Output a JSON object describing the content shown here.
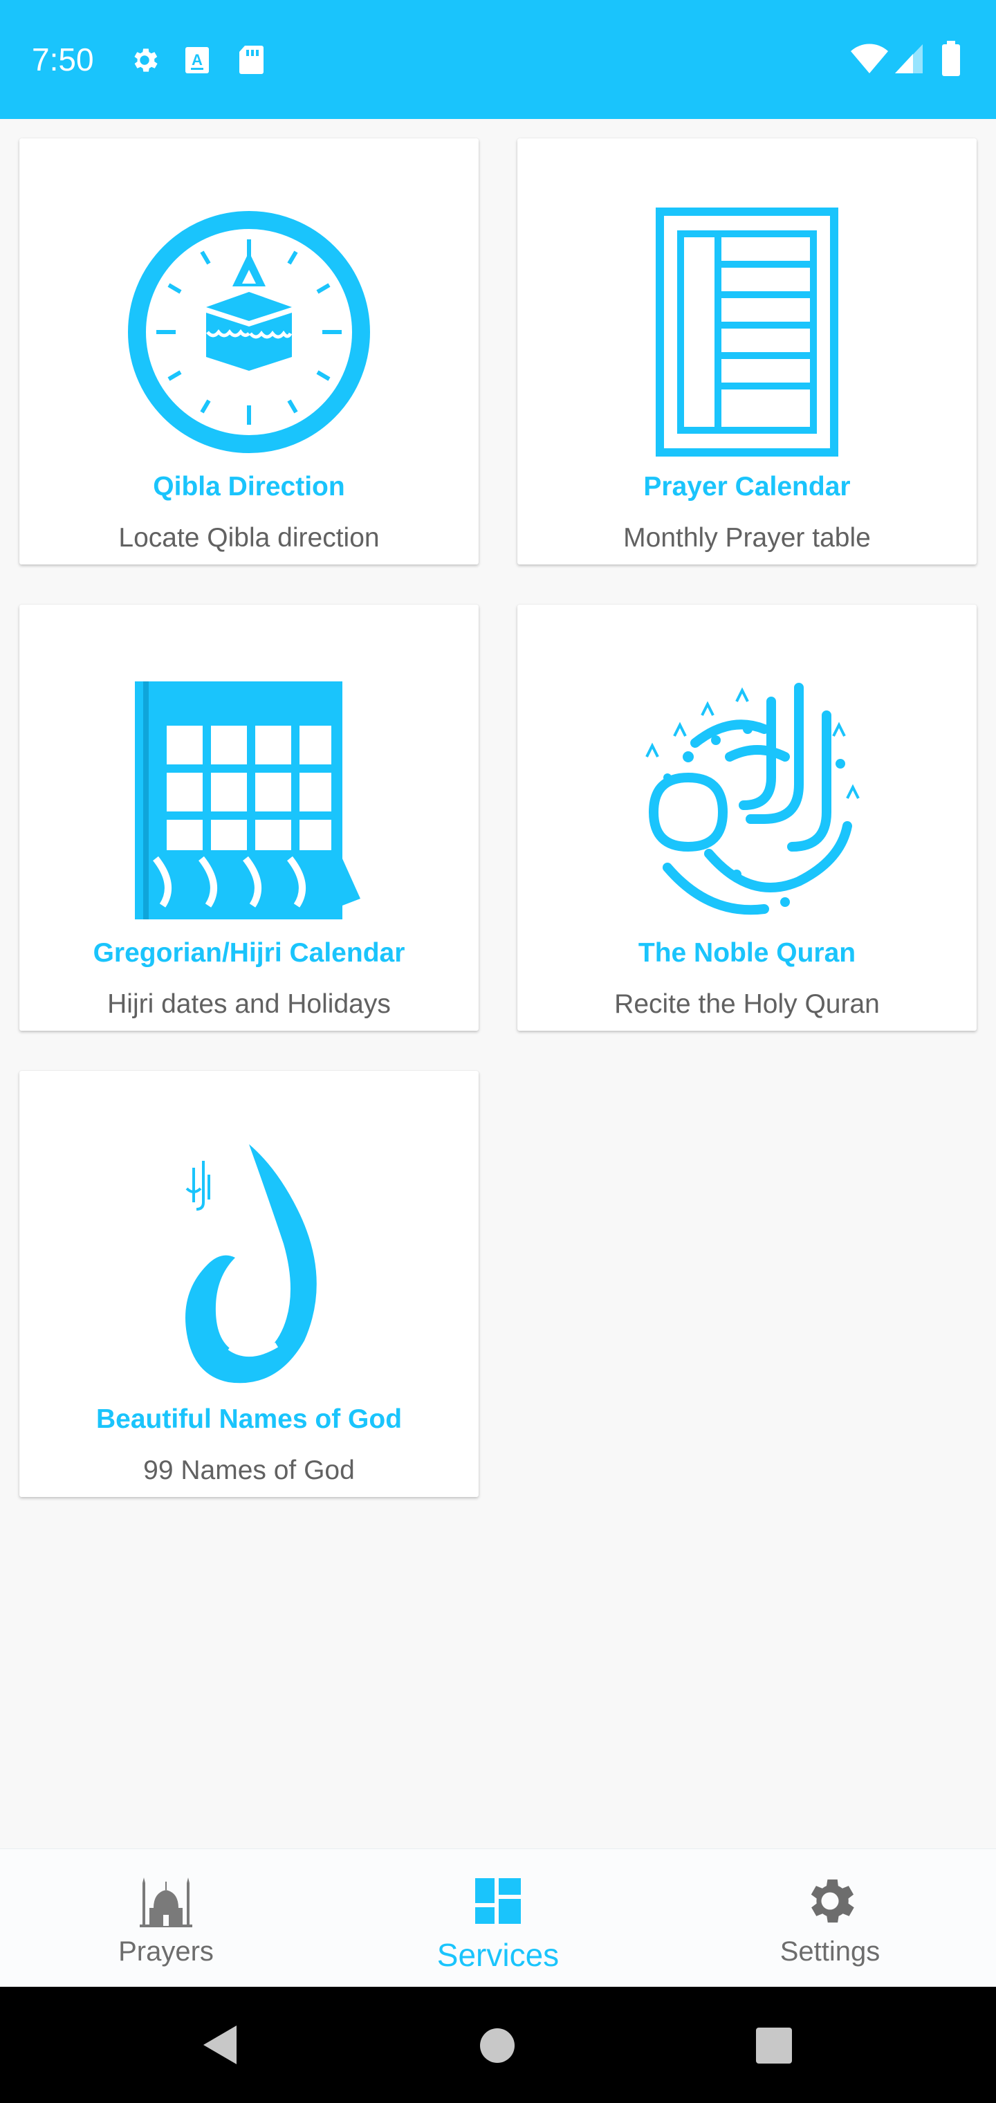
{
  "status_bar": {
    "time": "7:50",
    "background_color": "#1ac4fc",
    "left_icons": [
      "gear-icon",
      "font-a-icon",
      "sd-card-icon"
    ],
    "right_icons": [
      "wifi-icon",
      "cell-signal-icon",
      "battery-icon"
    ]
  },
  "services": [
    {
      "title": "Qibla Direction",
      "subtitle": "Locate Qibla direction",
      "icon": "qibla-compass-icon"
    },
    {
      "title": "Prayer Calendar",
      "subtitle": "Monthly Prayer table",
      "icon": "prayer-table-icon"
    },
    {
      "title": "Gregorian/Hijri Calendar",
      "subtitle": "Hijri dates and Holidays",
      "icon": "calendar-icon"
    },
    {
      "title": "The Noble Quran",
      "subtitle": "Recite the Holy Quran",
      "icon": "quran-calligraphy-icon"
    },
    {
      "title": "Beautiful Names of God",
      "subtitle": "99 Names of God",
      "icon": "allah-calligraphy-icon"
    }
  ],
  "bottom_nav": {
    "items": [
      {
        "label": "Prayers",
        "icon": "mosque-icon",
        "active": false
      },
      {
        "label": "Services",
        "icon": "dashboard-icon",
        "active": true
      },
      {
        "label": "Settings",
        "icon": "gear-icon",
        "active": false
      }
    ]
  },
  "colors": {
    "accent": "#1ac4fc",
    "subtitle_text": "#616161",
    "inactive_nav": "#6d6d6d",
    "background": "#f8f8f8"
  }
}
